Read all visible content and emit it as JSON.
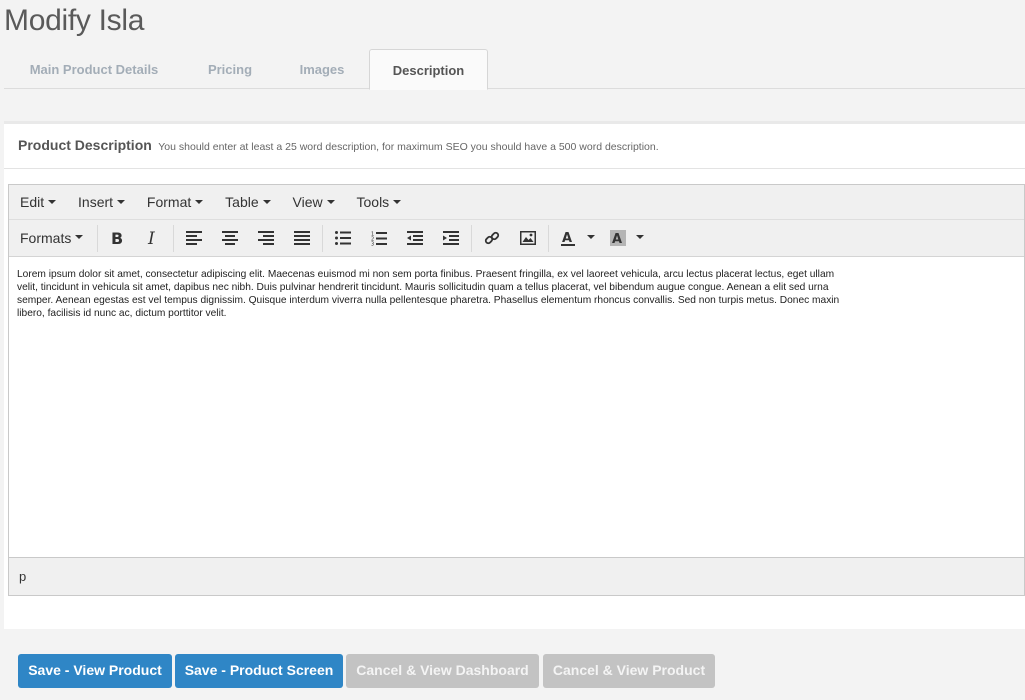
{
  "page": {
    "title": "Modify Isla"
  },
  "tabs": [
    {
      "label": "Main Product Details",
      "active": false
    },
    {
      "label": "Pricing",
      "active": false
    },
    {
      "label": "Images",
      "active": false
    },
    {
      "label": "Description",
      "active": true
    }
  ],
  "panel": {
    "title": "Product Description",
    "note": "You should enter at least a 25 word description, for maximum SEO you should have a 500 word description."
  },
  "editor": {
    "menus": [
      "Edit",
      "Insert",
      "Format",
      "Table",
      "View",
      "Tools"
    ],
    "formats_label": "Formats",
    "toolbar_icons": [
      "bold-icon",
      "italic-icon",
      "align-left-icon",
      "align-center-icon",
      "align-right-icon",
      "align-justify-icon",
      "bullet-list-icon",
      "numbered-list-icon",
      "outdent-icon",
      "indent-icon",
      "link-icon",
      "image-icon",
      "text-color-icon",
      "background-color-icon"
    ],
    "content_lines": [
      "Lorem ipsum dolor sit amet, consectetur adipiscing elit. Maecenas euismod mi non sem porta finibus. Praesent fringilla, ex vel laoreet vehicula, arcu lectus placerat lectus, eget ullam",
      "velit, tincidunt in vehicula sit amet, dapibus nec nibh. Duis pulvinar hendrerit tincidunt. Mauris sollicitudin quam a tellus placerat, vel bibendum augue congue. Aenean a elit sed urna",
      "semper. Aenean egestas est vel tempus dignissim. Quisque interdum viverra nulla pellentesque pharetra. Phasellus elementum rhoncus convallis. Sed non turpis metus. Donec maxin",
      "libero, facilisis id nunc ac, dictum porttitor velit."
    ],
    "status_path": "p"
  },
  "actions": [
    {
      "label": "Save - View Product",
      "style": "primary"
    },
    {
      "label": "Save - Product Screen",
      "style": "primary"
    },
    {
      "label": "Cancel & View Dashboard",
      "style": "muted"
    },
    {
      "label": "Cancel & View Product",
      "style": "muted"
    }
  ],
  "colors": {
    "primary_button": "#2f86c6",
    "muted_button": "#c3c3c3",
    "page_background": "#f3f3f3"
  }
}
